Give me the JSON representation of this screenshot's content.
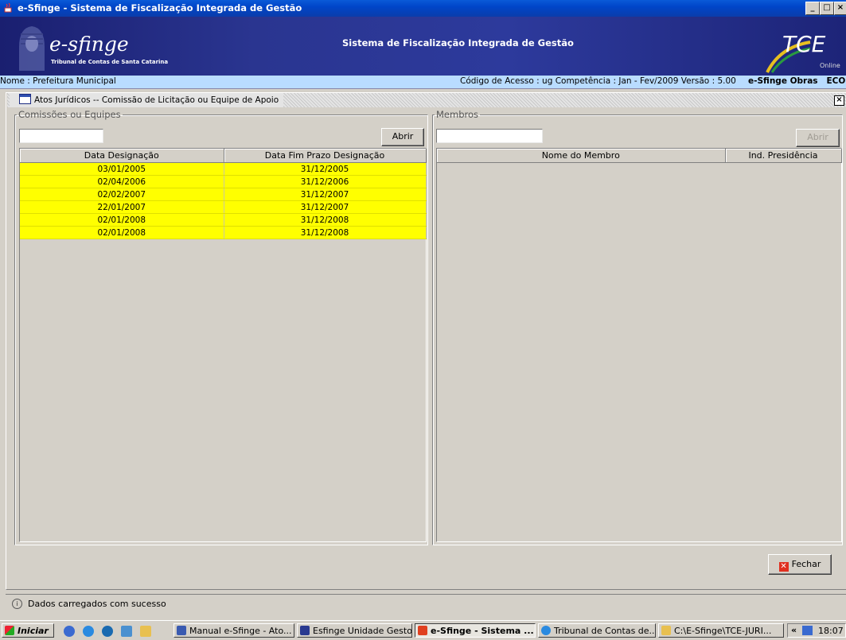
{
  "window": {
    "title": "e-Sfinge - Sistema de Fiscalização Integrada de Gestão",
    "controls": [
      "_",
      "□",
      "×"
    ]
  },
  "banner": {
    "logo_text": "e-sfinge",
    "logo_subtitle": "Tribunal de Contas de Santa Catarina",
    "center_title": "Sistema de Fiscalização Integrada de Gestão",
    "right_logo": "TCE",
    "right_logo_sub": "Online"
  },
  "info_bar": {
    "left": "Nome : Prefeitura Municipal",
    "right_plain": "Código de Acesso : ug   Competência : Jan - Fev/2009   Versão : 5.00",
    "right_bold": "e-Sfinge Obras   ECO"
  },
  "dialog": {
    "title": "Atos Jurídicos -- Comissão de Licitação ou Equipe de Apoio",
    "close_label": "×",
    "left_group": {
      "legend": "Comissões ou Equipes",
      "search_value": "",
      "open_button": "Abrir",
      "columns": [
        "Data Designação",
        "Data Fim Prazo Designação"
      ],
      "rows": [
        [
          "03/01/2005",
          "31/12/2005"
        ],
        [
          "02/04/2006",
          "31/12/2006"
        ],
        [
          "02/02/2007",
          "31/12/2007"
        ],
        [
          "22/01/2007",
          "31/12/2007"
        ],
        [
          "02/01/2008",
          "31/12/2008"
        ],
        [
          "02/01/2008",
          "31/12/2008"
        ]
      ],
      "row_color": "#ffff00"
    },
    "right_group": {
      "legend": "Membros",
      "search_value": "",
      "open_button": "Abrir",
      "columns": [
        "Nome do Membro",
        "Ind. Presidência"
      ]
    },
    "close_button": "Fechar"
  },
  "status": {
    "icon": "info-icon",
    "text": "Dados carregados com sucesso"
  },
  "taskbar": {
    "start": "Iniciar",
    "tasks": [
      {
        "label": "Manual e-Sfinge - Ato...",
        "icon": "word-icon",
        "active": false
      },
      {
        "label": "Esfinge Unidade Gestora",
        "icon": "tce-icon",
        "active": false
      },
      {
        "label": "e-Sfinge - Sistema ...",
        "icon": "java-icon",
        "active": true
      },
      {
        "label": "Tribunal de Contas de...",
        "icon": "ie-icon",
        "active": false
      },
      {
        "label": "C:\\E-Sfinge\\TCE-JURI...",
        "icon": "folder-icon",
        "active": false
      }
    ],
    "tray_expand": "«",
    "clock": "18:07"
  }
}
